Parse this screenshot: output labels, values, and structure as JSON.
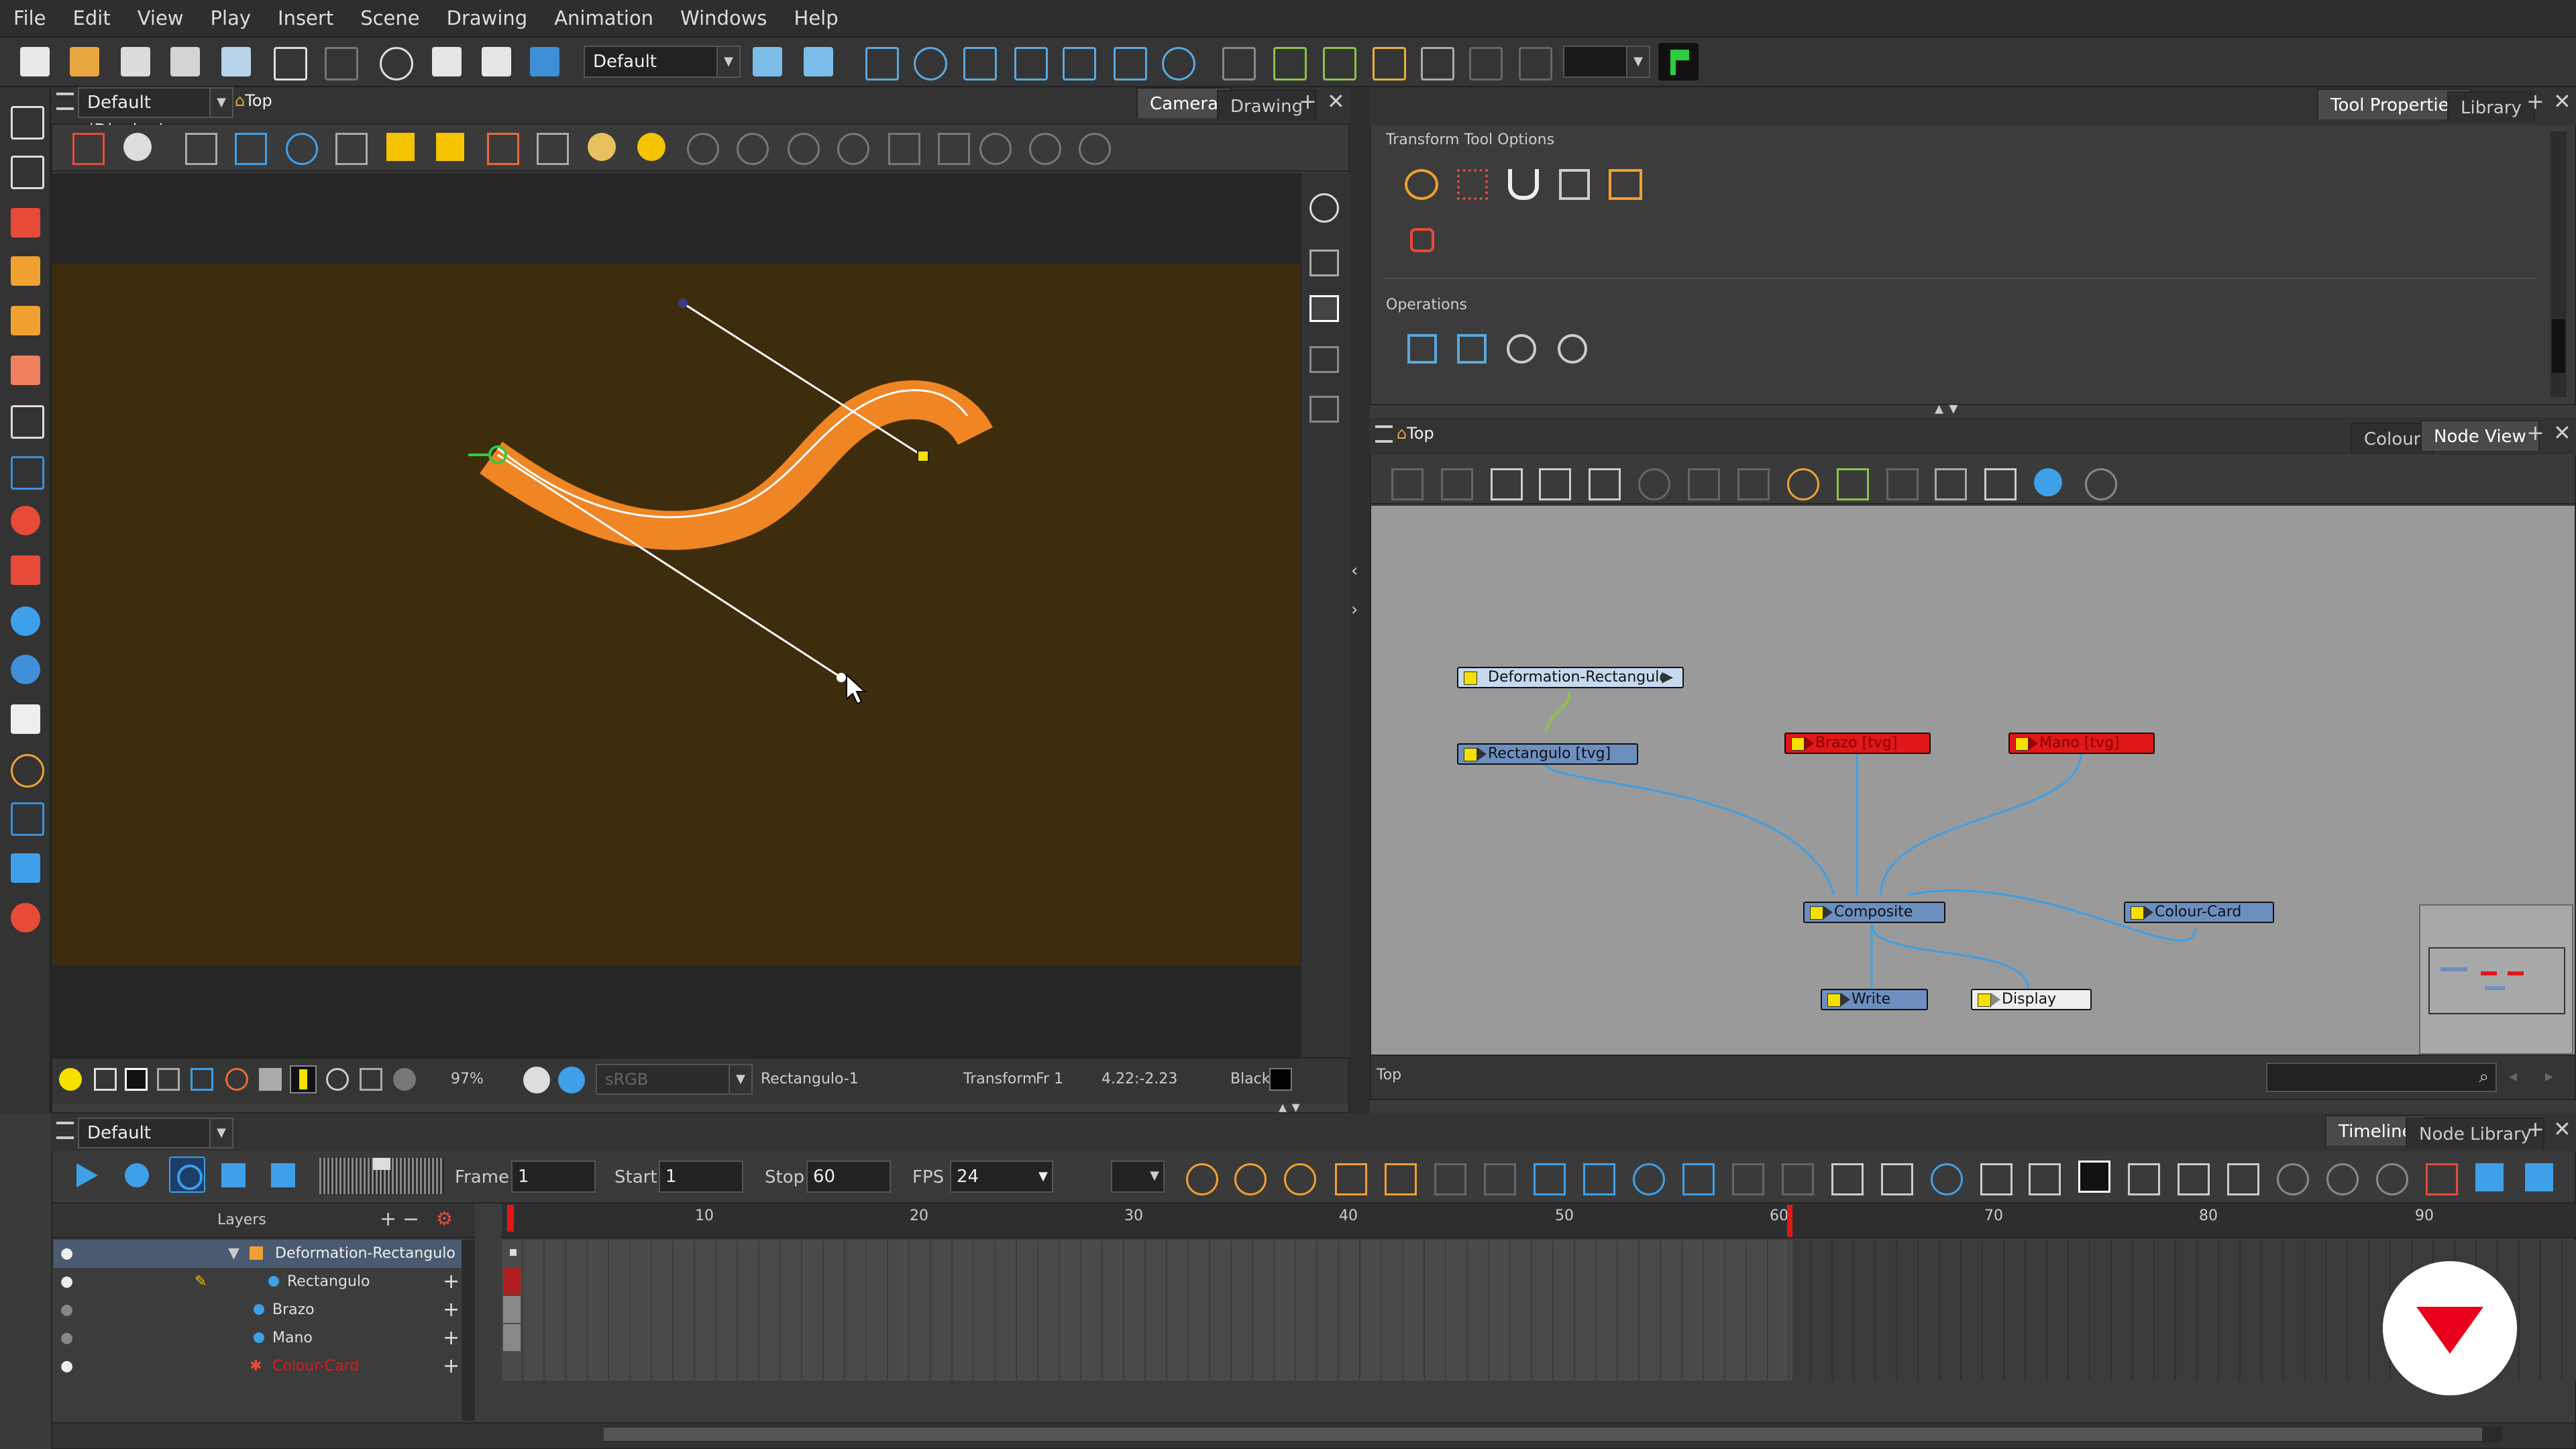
{
  "menu": [
    "File",
    "Edit",
    "View",
    "Play",
    "Insert",
    "Scene",
    "Drawing",
    "Animation",
    "Windows",
    "Help"
  ],
  "toolbar": {
    "workspace": "Default"
  },
  "camera_view": {
    "view_select": "Default (Display)",
    "breadcrumb": "Top",
    "tabs": [
      "Camera",
      "Drawing"
    ],
    "status": {
      "zoom": "97%",
      "colorspace": "sRGB",
      "drawing": "Rectangulo-1",
      "tool": "Transform",
      "frame": "Fr 1",
      "coords": "4.22:-2.23",
      "color_name": "Black"
    },
    "colors": {
      "stage_bg": "#3e2d0c",
      "shape": "#f08524",
      "outer": "#262626"
    }
  },
  "tool_properties": {
    "tabs": [
      "Tool Properties",
      "Library"
    ],
    "title": "Transform Tool Options",
    "operations_label": "Operations"
  },
  "node_view": {
    "breadcrumb": "Top",
    "tabs": [
      "Colour",
      "Node View"
    ],
    "nodes": [
      {
        "label": "Deformation-Rectangulo"
      },
      {
        "label": "Rectangulo [tvg]"
      },
      {
        "label": "Brazo [tvg]"
      },
      {
        "label": "Mano [tvg]"
      },
      {
        "label": "Composite"
      },
      {
        "label": "Colour-Card"
      },
      {
        "label": "Write"
      },
      {
        "label": "Display"
      }
    ],
    "footer": "Top"
  },
  "timeline": {
    "view_select": "Default (Display)",
    "tabs": [
      "Timeline",
      "Node Library"
    ],
    "frame_label": "Frame",
    "frame": "1",
    "start_label": "Start",
    "start": "1",
    "stop_label": "Stop",
    "stop": "60",
    "fps_label": "FPS",
    "fps": "24",
    "layers_label": "Layers",
    "layers": [
      {
        "name": "Deformation-Rectangulo"
      },
      {
        "name": "Rectangulo"
      },
      {
        "name": "Brazo"
      },
      {
        "name": "Mano"
      },
      {
        "name": "Colour-Card"
      }
    ],
    "ruler": [
      "10",
      "20",
      "30",
      "40",
      "50",
      "60",
      "70",
      "80",
      "90"
    ]
  },
  "brand": {
    "accent": "#e8001c"
  }
}
